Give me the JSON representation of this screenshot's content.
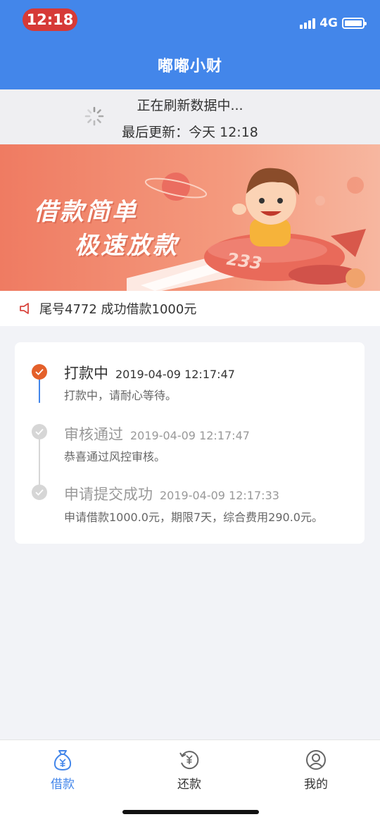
{
  "status_bar": {
    "time": "12:18",
    "network": "4G"
  },
  "nav": {
    "title": "嘟嘟小财"
  },
  "refresh": {
    "status": "正在刷新数据中...",
    "last_update": "最后更新：今天 12:18"
  },
  "banner": {
    "line1": "借款简单",
    "line2": "极速放款",
    "rocket_number": "233"
  },
  "notice": {
    "text": "尾号4772 成功借款1000元"
  },
  "timeline": [
    {
      "title": "打款中",
      "time": "2019-04-09 12:17:47",
      "desc": "打款中，请耐心等待。",
      "state": "active"
    },
    {
      "title": "审核通过",
      "time": "2019-04-09 12:17:47",
      "desc": "恭喜通过风控审核。",
      "state": "done"
    },
    {
      "title": "申请提交成功",
      "time": "2019-04-09 12:17:33",
      "desc": "申请借款1000.0元，期限7天，综合费用290.0元。",
      "state": "done"
    }
  ],
  "tabbar": {
    "items": [
      {
        "label": "借款",
        "icon": "money-bag-icon",
        "active": true
      },
      {
        "label": "还款",
        "icon": "repay-icon",
        "active": false
      },
      {
        "label": "我的",
        "icon": "profile-icon",
        "active": false
      }
    ]
  },
  "colors": {
    "primary": "#4386ea",
    "active_step": "#e4602a",
    "banner": "#ef7b62",
    "time_pill": "#d63a37"
  }
}
